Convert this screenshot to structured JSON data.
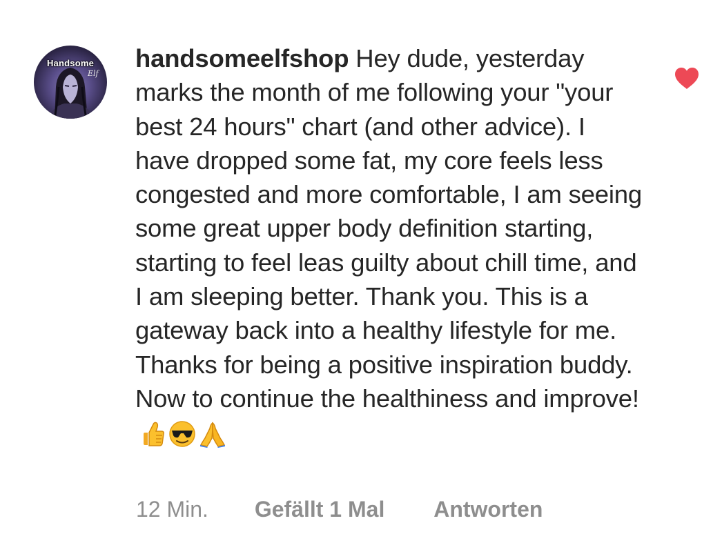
{
  "comment": {
    "avatar_text": "Handsome",
    "avatar_script": "Elf",
    "username": "handsomeelfshop",
    "text": "Hey dude, yesterday marks the month of me following your \"your best 24 hours\" chart (and other advice). I have dropped some fat, my core feels less congested and more comfortable, I am seeing some great upper body definition starting, starting to feel leas guilty about chill time, and I am sleeping better. Thank you. This is a gateway back into a healthy lifestyle for me. Thanks for being a positive inspiration buddy. Now to continue the healthiness and improve!",
    "emojis": [
      "thumbs-up-icon",
      "sunglasses-face-icon",
      "folded-hands-icon"
    ],
    "time": "12 Min.",
    "likes": "Gefällt 1 Mal",
    "reply_label": "Antworten",
    "liked": true
  },
  "colors": {
    "heart": "#ed4956",
    "meta_text": "#8e8e8e",
    "body_text": "#262626"
  }
}
